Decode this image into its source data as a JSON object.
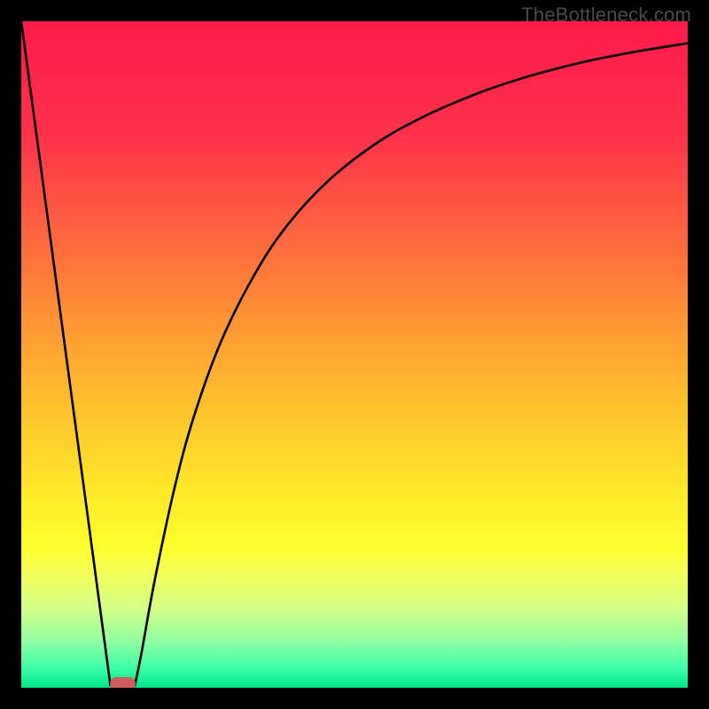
{
  "watermark": "TheBottleneck.com",
  "colors": {
    "frame": "#000000",
    "curve": "#000000",
    "marker": "#cd5c5c",
    "gradient_stops": [
      {
        "pct": 0,
        "color": "#ff1a4b"
      },
      {
        "pct": 18,
        "color": "#ff344a"
      },
      {
        "pct": 38,
        "color": "#ff7b3a"
      },
      {
        "pct": 55,
        "color": "#ffb92e"
      },
      {
        "pct": 70,
        "color": "#ffe629"
      },
      {
        "pct": 79,
        "color": "#ffff2f"
      },
      {
        "pct": 83,
        "color": "#f3ff5a"
      },
      {
        "pct": 88,
        "color": "#d4ff87"
      },
      {
        "pct": 93,
        "color": "#93ffa3"
      },
      {
        "pct": 97,
        "color": "#3effa8"
      },
      {
        "pct": 100,
        "color": "#00e589"
      }
    ]
  },
  "chart_data": {
    "type": "line",
    "title": "",
    "xlabel": "",
    "ylabel": "",
    "xlim": [
      0,
      100
    ],
    "ylim": [
      0,
      100
    ],
    "grid": false,
    "legend": false,
    "series": [
      {
        "name": "left-branch",
        "x": [
          0,
          2,
          4,
          6,
          8,
          10,
          12,
          13.4
        ],
        "values": [
          100,
          85.1,
          70.2,
          55.3,
          40.4,
          25.5,
          10.6,
          0.2
        ]
      },
      {
        "name": "right-branch",
        "x": [
          17.0,
          18,
          20,
          23,
          26,
          30,
          35,
          40,
          46,
          53,
          60,
          68,
          76,
          84,
          92,
          100
        ],
        "values": [
          0.2,
          5,
          16,
          30,
          41,
          52,
          62,
          69.5,
          76,
          81.5,
          85.5,
          89,
          91.7,
          93.8,
          95.4,
          96.7
        ]
      }
    ],
    "annotations": [
      {
        "name": "min-marker",
        "x": 15.2,
        "y": 0.6,
        "w": 3.8,
        "h": 1.9
      }
    ]
  }
}
